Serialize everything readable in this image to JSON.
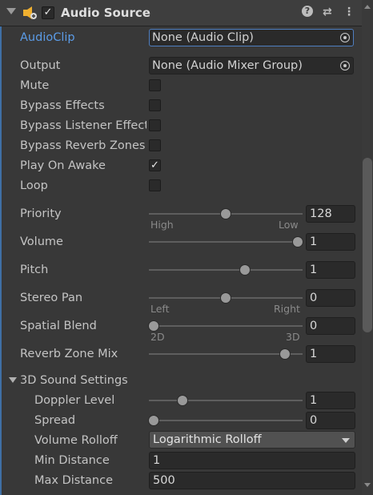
{
  "component": {
    "title": "Audio Source",
    "enabled_mark": "✓",
    "header_icons": [
      "help-icon",
      "preset-icon",
      "more-menu-icon"
    ],
    "help_glyph": "?",
    "preset_glyph": "⇄",
    "more_glyph": "⋮"
  },
  "fields": {
    "audio_clip": {
      "label": "AudioClip",
      "value": "None (Audio Clip)"
    },
    "output": {
      "label": "Output",
      "value": "None (Audio Mixer Group)"
    }
  },
  "toggles": [
    {
      "label": "Mute",
      "checked": false,
      "mark": ""
    },
    {
      "label": "Bypass Effects",
      "checked": false,
      "mark": ""
    },
    {
      "label": "Bypass Listener Effects",
      "checked": false,
      "mark": ""
    },
    {
      "label": "Bypass Reverb Zones",
      "checked": false,
      "mark": ""
    },
    {
      "label": "Play On Awake",
      "checked": true,
      "mark": "✓"
    },
    {
      "label": "Loop",
      "checked": false,
      "mark": ""
    }
  ],
  "sliders": [
    {
      "label": "Priority",
      "value": "128",
      "fraction": 0.5,
      "min_label": "High",
      "max_label": "Low"
    },
    {
      "label": "Volume",
      "value": "1",
      "fraction": 1.0
    },
    {
      "label": "Pitch",
      "value": "1",
      "fraction": 0.633
    },
    {
      "label": "Stereo Pan",
      "value": "0",
      "fraction": 0.5,
      "min_label": "Left",
      "max_label": "Right"
    },
    {
      "label": "Spatial Blend",
      "value": "0",
      "fraction": 0.0,
      "min_label": "2D",
      "max_label": "3D"
    },
    {
      "label": "Reverb Zone Mix",
      "value": "1",
      "fraction": 0.909
    }
  ],
  "sound_3d": {
    "label": "3D Sound Settings",
    "doppler": {
      "label": "Doppler Level",
      "value": "1",
      "fraction": 0.2
    },
    "spread": {
      "label": "Spread",
      "value": "0",
      "fraction": 0.0
    },
    "rolloff": {
      "label": "Volume Rolloff",
      "value": "Logarithmic Rolloff"
    },
    "min_distance": {
      "label": "Min Distance",
      "value": "1"
    },
    "max_distance": {
      "label": "Max Distance",
      "value": "500"
    }
  },
  "colors": {
    "background": "#383838",
    "accent_label": "#5b9be6",
    "selection_border": "#4f7fc1"
  }
}
